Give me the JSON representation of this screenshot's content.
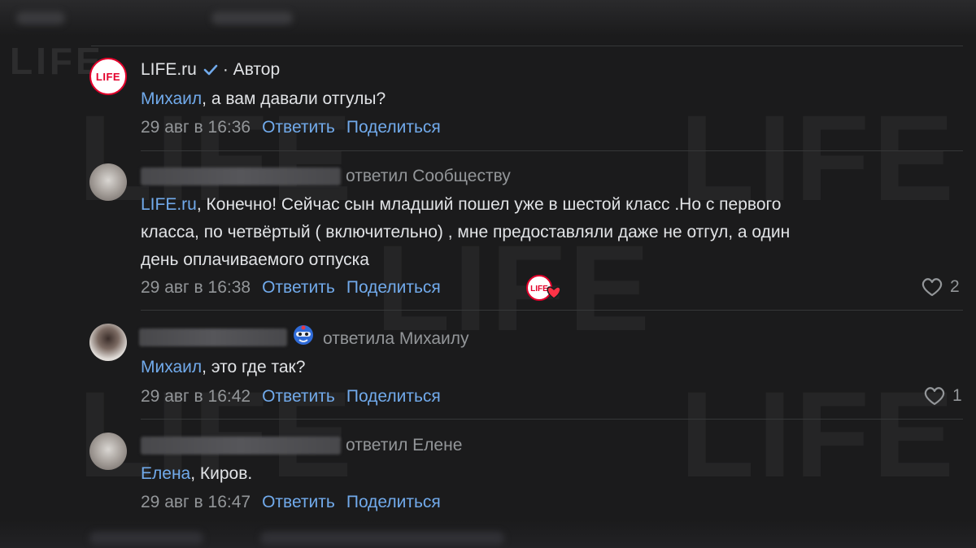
{
  "watermark": "LIFE",
  "comments": [
    {
      "author": "LIFE.ru",
      "verified": true,
      "role": "· Автор",
      "avatar_text": "LIFE",
      "mention": "Михаил",
      "text": ", а вам давали отгулы?",
      "time": "29 авг в 16:36",
      "reply": "Ответить",
      "share": "Поделиться"
    },
    {
      "replied_to": "ответил Сообществу",
      "mention": "LIFE.ru",
      "text_lines": [
        ", Конечно! Сейчас сын младший пошел уже в шестой класс .Но с первого",
        "класса, по четвёртый ( включительно) , мне предоставляли даже не отгул, а один",
        "день оплачиваемого отпуска"
      ],
      "time": "29 авг в 16:38",
      "reply": "Ответить",
      "share": "Поделиться",
      "reaction_badge": "LIFE",
      "likes": "2"
    },
    {
      "replied_to": "ответила Михаилу",
      "mention": "Михаил",
      "text": ", это где так?",
      "time": "29 авг в 16:42",
      "reply": "Ответить",
      "share": "Поделиться",
      "likes": "1"
    },
    {
      "replied_to": "ответил Елене",
      "mention": "Елена",
      "text": ", Киров.",
      "time": "29 авг в 16:47",
      "reply": "Ответить",
      "share": "Поделиться"
    }
  ],
  "colors": {
    "background": "#1b1b1c",
    "link": "#71aaeb",
    "secondary": "#939699",
    "brand": "#e3002b"
  }
}
